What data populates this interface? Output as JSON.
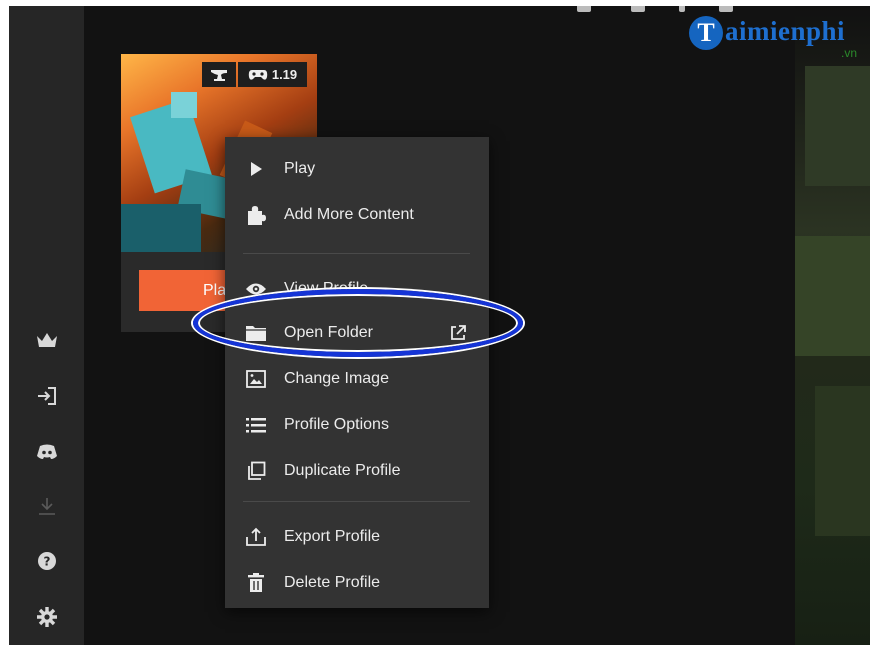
{
  "watermark": {
    "logo_letter": "T",
    "logo_text": "aimienphi",
    "logo_suffix": ".vn"
  },
  "profile_card": {
    "loader_icon": "anvil-icon",
    "version_icon": "gamepad-icon",
    "version": "1.19",
    "play_label": "Pla"
  },
  "sidebar": {
    "icons": [
      "crown-icon",
      "login-icon",
      "discord-icon",
      "download-icon",
      "help-icon",
      "gear-icon"
    ]
  },
  "context_menu": {
    "items": [
      {
        "label": "Play",
        "icon": "play-icon"
      },
      {
        "label": "Add More Content",
        "icon": "puzzle-icon"
      },
      {
        "label": "View Profile",
        "icon": "eye-icon"
      },
      {
        "label": "Open Folder",
        "icon": "folder-icon",
        "external_icon": "external-link-icon"
      },
      {
        "label": "Change Image",
        "icon": "image-icon"
      },
      {
        "label": "Profile Options",
        "icon": "list-icon"
      },
      {
        "label": "Duplicate Profile",
        "icon": "duplicate-icon"
      },
      {
        "label": "Export Profile",
        "icon": "export-icon"
      },
      {
        "label": "Delete Profile",
        "icon": "trash-icon"
      }
    ]
  },
  "highlight": {
    "target": "Open Folder",
    "color": "#1534d6"
  },
  "colors": {
    "accent": "#f16436",
    "menu_bg": "#333333",
    "sidebar_bg": "#262626"
  }
}
